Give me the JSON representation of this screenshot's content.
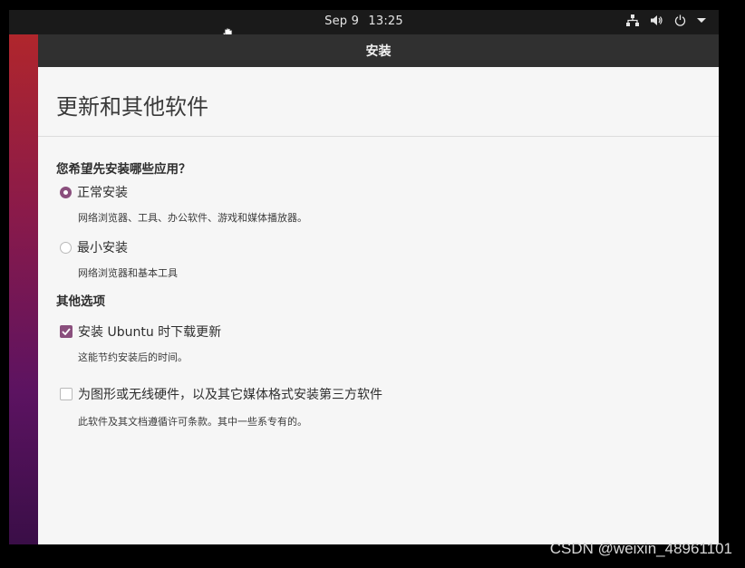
{
  "topbar": {
    "date": "Sep 9",
    "time": "13:25",
    "icons": [
      "network-icon",
      "volume-icon",
      "power-icon",
      "menu-arrow-icon"
    ]
  },
  "window": {
    "title": "安装"
  },
  "page": {
    "heading": "更新和其他软件",
    "question": "您希望先安装哪些应用？",
    "install_options": [
      {
        "label": "正常安装",
        "description": "网络浏览器、工具、办公软件、游戏和媒体播放器。",
        "selected": true
      },
      {
        "label": "最小安装",
        "description": "网络浏览器和基本工具",
        "selected": false
      }
    ],
    "other_heading": "其他选项",
    "other_options": [
      {
        "label": "安装 Ubuntu 时下载更新",
        "description": "这能节约安装后的时间。",
        "checked": true
      },
      {
        "label": "为图形或无线硬件，以及其它媒体格式安装第三方软件",
        "description": "此软件及其文档遵循许可条款。其中一些系专有的。",
        "checked": false
      }
    ]
  },
  "accent_color": "#8a4f7d",
  "watermark": "CSDN @weixin_48961101"
}
